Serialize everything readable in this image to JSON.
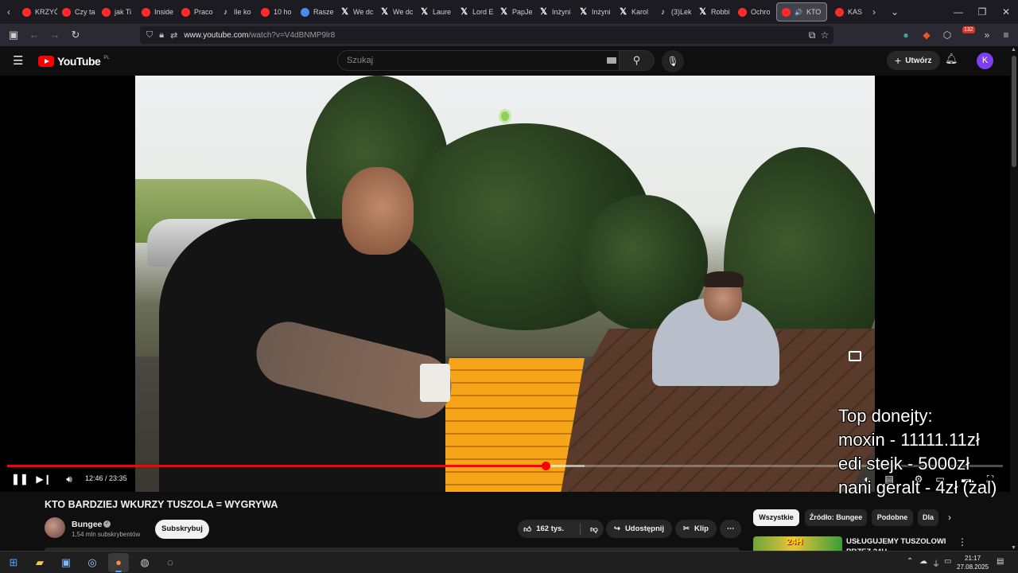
{
  "browser": {
    "tabs": [
      {
        "label": "KRZYĆ",
        "icon": "youtube-icon"
      },
      {
        "label": "Czy ta",
        "icon": "youtube-icon"
      },
      {
        "label": "jak Ti",
        "icon": "youtube-icon"
      },
      {
        "label": "Inside",
        "icon": "youtube-icon"
      },
      {
        "label": "Praco",
        "icon": "youtube-icon"
      },
      {
        "label": "Ile ko",
        "icon": "tiktok-icon"
      },
      {
        "label": "10 ho",
        "icon": "youtube-icon"
      },
      {
        "label": "Rasze",
        "icon": "google-icon"
      },
      {
        "label": "We dc",
        "icon": "x-icon"
      },
      {
        "label": "We dc",
        "icon": "x-icon"
      },
      {
        "label": "Laure",
        "icon": "x-icon"
      },
      {
        "label": "Lord E",
        "icon": "x-icon"
      },
      {
        "label": "PapJe",
        "icon": "x-icon"
      },
      {
        "label": "Inżyni",
        "icon": "x-icon"
      },
      {
        "label": "Inżyni",
        "icon": "x-icon"
      },
      {
        "label": "Karol",
        "icon": "x-icon"
      },
      {
        "label": "(3)Lek",
        "icon": "tiktok-icon"
      },
      {
        "label": "Robbi",
        "icon": "x-icon"
      },
      {
        "label": "Ochro",
        "icon": "youtube-icon"
      }
    ],
    "active_tab": {
      "label": "KTO",
      "icon": "youtube-icon"
    },
    "after_active_tab": {
      "label": "KAS",
      "icon": "youtube-icon"
    },
    "url_host": "www.youtube.com",
    "url_path": "/watch?v=V4dBNMP9lr8",
    "extension_badge": "132"
  },
  "youtube": {
    "logo_text": "YouTube",
    "country_code": "PL",
    "search_placeholder": "Szukaj",
    "create_label": "Utwórz",
    "avatar_letter": "K"
  },
  "player": {
    "overlay_lines": [
      "Top donejty:",
      "moxin - 11111.11zł",
      "edi stejk - 5000zł",
      "nani geralt - 4zł (żal)"
    ],
    "current_time": "12:46",
    "duration": "23:35",
    "time_separator": " / ",
    "played_fraction": 0.541,
    "buffered_fraction": 0.58
  },
  "video": {
    "title": "KTO BARDZIEJ WKURZY TUSZOLA = WYGRYWA",
    "channel_name": "Bungee",
    "subscribers": "1,54 mln subskrybentów",
    "subscribe_label": "Subskrybuj",
    "likes": "162 tys.",
    "share_label": "Udostępnij",
    "clip_label": "Klip"
  },
  "sidebar": {
    "chips": [
      "Wszystkie",
      "Źródło: Bungee",
      "Podobne",
      "Dla"
    ],
    "recommended_title": "USŁUGUJEMY TUSZOLOWI PRZEZ 24H",
    "recommended_thumb_text": "24H"
  },
  "taskbar": {
    "time": "21:17",
    "date": "27.08.2025"
  },
  "colors": {
    "accent_red": "#ff0000",
    "avatar_purple": "#7e3ff2",
    "chip_selected": "#f1f1f1"
  }
}
